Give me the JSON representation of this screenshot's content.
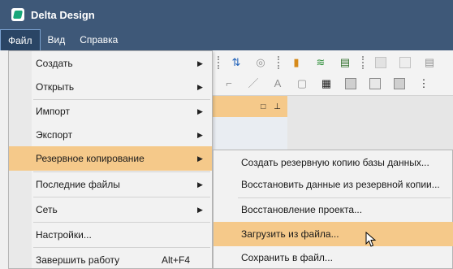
{
  "window": {
    "title": "Delta Design",
    "icon": "delta-design-logo-icon"
  },
  "menubar": {
    "items": [
      "Файл",
      "Вид",
      "Справка"
    ],
    "active": 0
  },
  "file_menu": {
    "items": [
      {
        "label": "Создать",
        "submenu": true
      },
      {
        "label": "Открыть",
        "submenu": true
      },
      {
        "label": "Импорт",
        "submenu": true
      },
      {
        "label": "Экспорт",
        "submenu": true
      },
      {
        "label": "Резервное копирование",
        "submenu": true,
        "highlighted": true
      },
      {
        "label": "Последние файлы",
        "submenu": true
      },
      {
        "label": "Сеть",
        "submenu": true
      },
      {
        "label": "Настройки..."
      },
      {
        "label": "Завершить работу",
        "shortcut": "Alt+F4"
      }
    ]
  },
  "backup_submenu": {
    "items": [
      {
        "label": "Создать резервную копию базы данных..."
      },
      {
        "label": "Восстановить данные из резервной копии..."
      },
      {
        "label": "Восстановление проекта..."
      },
      {
        "label": "Загрузить из файла...",
        "highlighted": true
      },
      {
        "label": "Сохранить в файл..."
      }
    ]
  },
  "colors": {
    "titlebar": "#3e5878",
    "highlight": "#f5c98a",
    "menu_bg": "#f2f2f2"
  }
}
